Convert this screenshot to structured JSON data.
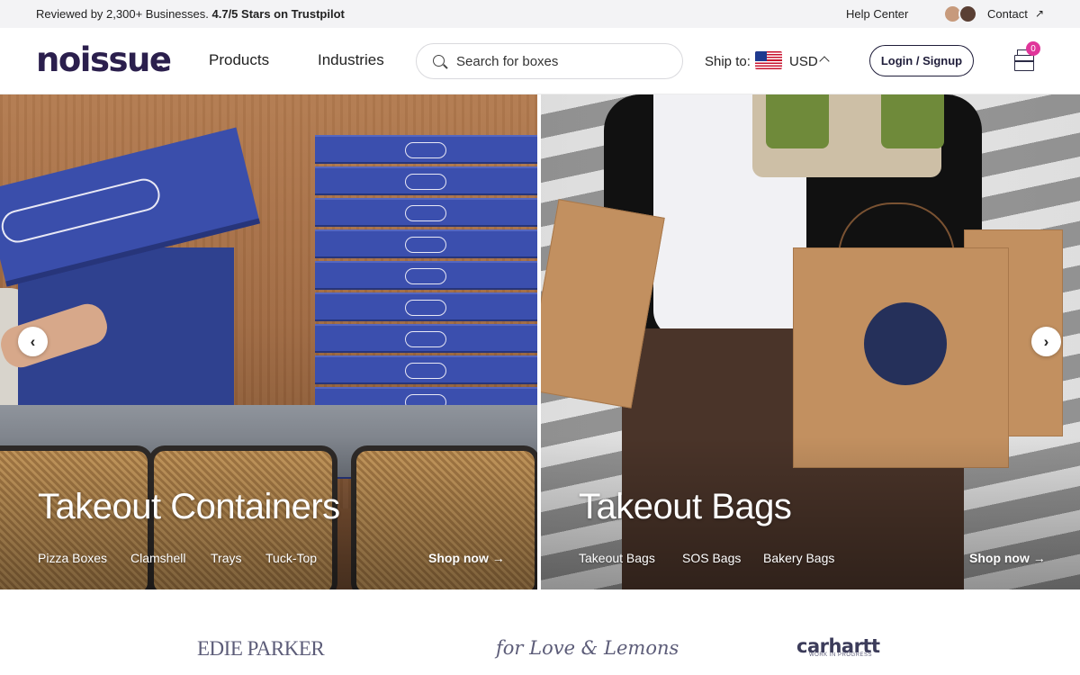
{
  "topbar": {
    "review_prefix": "Reviewed by 2,300+ Businesses.",
    "review_rating": "4.7/5 Stars on Trustpilot",
    "help": "Help Center",
    "contact": "Contact",
    "contact_arrow": "↗"
  },
  "header": {
    "logo": "noissue",
    "nav": [
      "Products",
      "Industries"
    ],
    "search_placeholder": "Search for boxes",
    "ship_label": "Ship to:",
    "currency": "USD",
    "login": "Login / Signup",
    "cart_count": "0"
  },
  "hero": {
    "left": {
      "title": "Takeout Containers",
      "links": [
        "Pizza Boxes",
        "Clamshell",
        "Trays",
        "Tuck-Top"
      ],
      "shop_now": "Shop now →"
    },
    "right": {
      "title": "Takeout Bags",
      "links": [
        "Takeout Bags",
        "SOS Bags",
        "Bakery Bags"
      ],
      "shop_now": "Shop now →"
    },
    "prev_icon": "‹",
    "next_icon": "›"
  },
  "brands": {
    "edie": "EDIE PARKER",
    "lemons": "for Love & Lemons",
    "carhartt": "carhartt",
    "carhartt_sub": "WORK IN PROGRESS"
  },
  "colors": {
    "brand": "#2b1f4d",
    "badge": "#e0359a",
    "topbar": "#f3f3f5"
  }
}
